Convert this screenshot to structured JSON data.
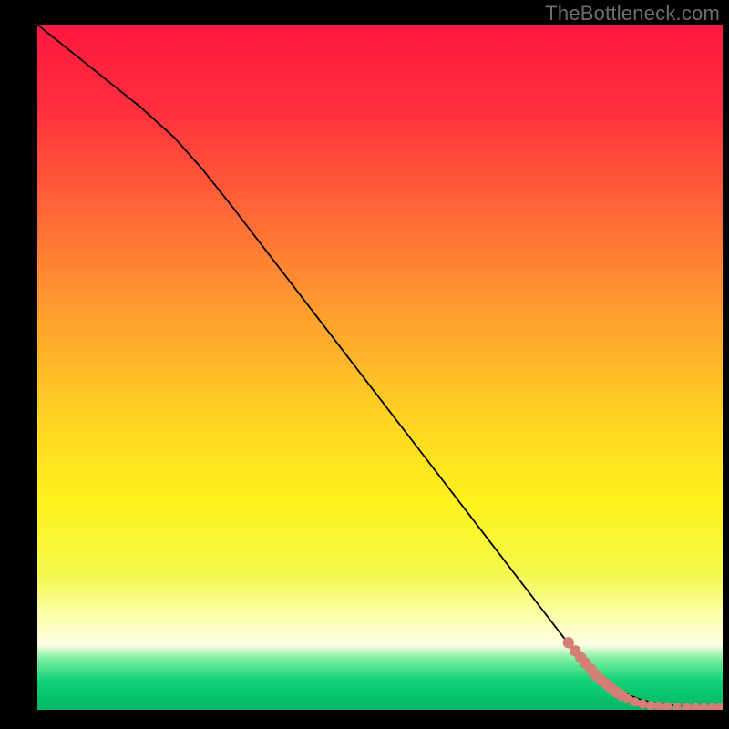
{
  "attribution": "TheBottleneck.com",
  "colors": {
    "frame_bg": "#000000",
    "attribution_text": "#6e6e6e",
    "curve_stroke": "#000000",
    "marker_fill": "#d57e76",
    "gradient_stops": [
      {
        "offset": 0.0,
        "color": "#ff183f"
      },
      {
        "offset": 0.12,
        "color": "#ff2e3e"
      },
      {
        "offset": 0.28,
        "color": "#ff6a36"
      },
      {
        "offset": 0.44,
        "color": "#ffa52d"
      },
      {
        "offset": 0.58,
        "color": "#ffd523"
      },
      {
        "offset": 0.7,
        "color": "#fff31e"
      },
      {
        "offset": 0.8,
        "color": "#f4f84b"
      },
      {
        "offset": 0.86,
        "color": "#fdfea7"
      },
      {
        "offset": 0.905,
        "color": "#ffffe5"
      },
      {
        "offset": 0.925,
        "color": "#7ff0a0"
      },
      {
        "offset": 0.955,
        "color": "#18d47a"
      },
      {
        "offset": 0.975,
        "color": "#08c770"
      },
      {
        "offset": 1.0,
        "color": "#06b566"
      }
    ]
  },
  "chart_data": {
    "type": "line",
    "title": "",
    "xlabel": "",
    "ylabel": "",
    "xlim": [
      0,
      100
    ],
    "ylim": [
      0,
      100
    ],
    "series": [
      {
        "name": "curve",
        "x": [
          0,
          5,
          10,
          15,
          20,
          24,
          28,
          32,
          36,
          40,
          44,
          48,
          52,
          56,
          60,
          64,
          68,
          72,
          76,
          78,
          80,
          82,
          84,
          86,
          88,
          90,
          92,
          94,
          96,
          98,
          100
        ],
        "y": [
          100,
          96,
          92,
          88,
          83.5,
          79,
          74,
          68.8,
          63.6,
          58.4,
          53.2,
          48,
          42.8,
          37.6,
          32.4,
          27.2,
          22,
          16.8,
          11.6,
          9.0,
          6.8,
          5.0,
          3.5,
          2.3,
          1.5,
          1.0,
          0.7,
          0.5,
          0.4,
          0.3,
          0.3
        ]
      }
    ],
    "markers": {
      "name": "cluster",
      "points": [
        {
          "x": 77.5,
          "y": 9.8
        },
        {
          "x": 78.5,
          "y": 8.6
        },
        {
          "x": 79.3,
          "y": 7.6
        },
        {
          "x": 80.0,
          "y": 6.8
        },
        {
          "x": 80.8,
          "y": 5.9
        },
        {
          "x": 81.5,
          "y": 5.1
        },
        {
          "x": 82.2,
          "y": 4.4
        },
        {
          "x": 83.0,
          "y": 3.8
        },
        {
          "x": 83.7,
          "y": 3.2
        },
        {
          "x": 84.5,
          "y": 2.6
        },
        {
          "x": 85.3,
          "y": 2.1
        },
        {
          "x": 86.2,
          "y": 1.6
        },
        {
          "x": 87.2,
          "y": 1.15
        },
        {
          "x": 88.3,
          "y": 0.85
        },
        {
          "x": 89.5,
          "y": 0.65
        },
        {
          "x": 90.7,
          "y": 0.52
        },
        {
          "x": 91.9,
          "y": 0.43
        },
        {
          "x": 93.3,
          "y": 0.37
        },
        {
          "x": 94.7,
          "y": 0.33
        },
        {
          "x": 96.0,
          "y": 0.31
        },
        {
          "x": 97.3,
          "y": 0.3
        },
        {
          "x": 98.6,
          "y": 0.3
        },
        {
          "x": 99.7,
          "y": 0.3
        }
      ]
    }
  }
}
